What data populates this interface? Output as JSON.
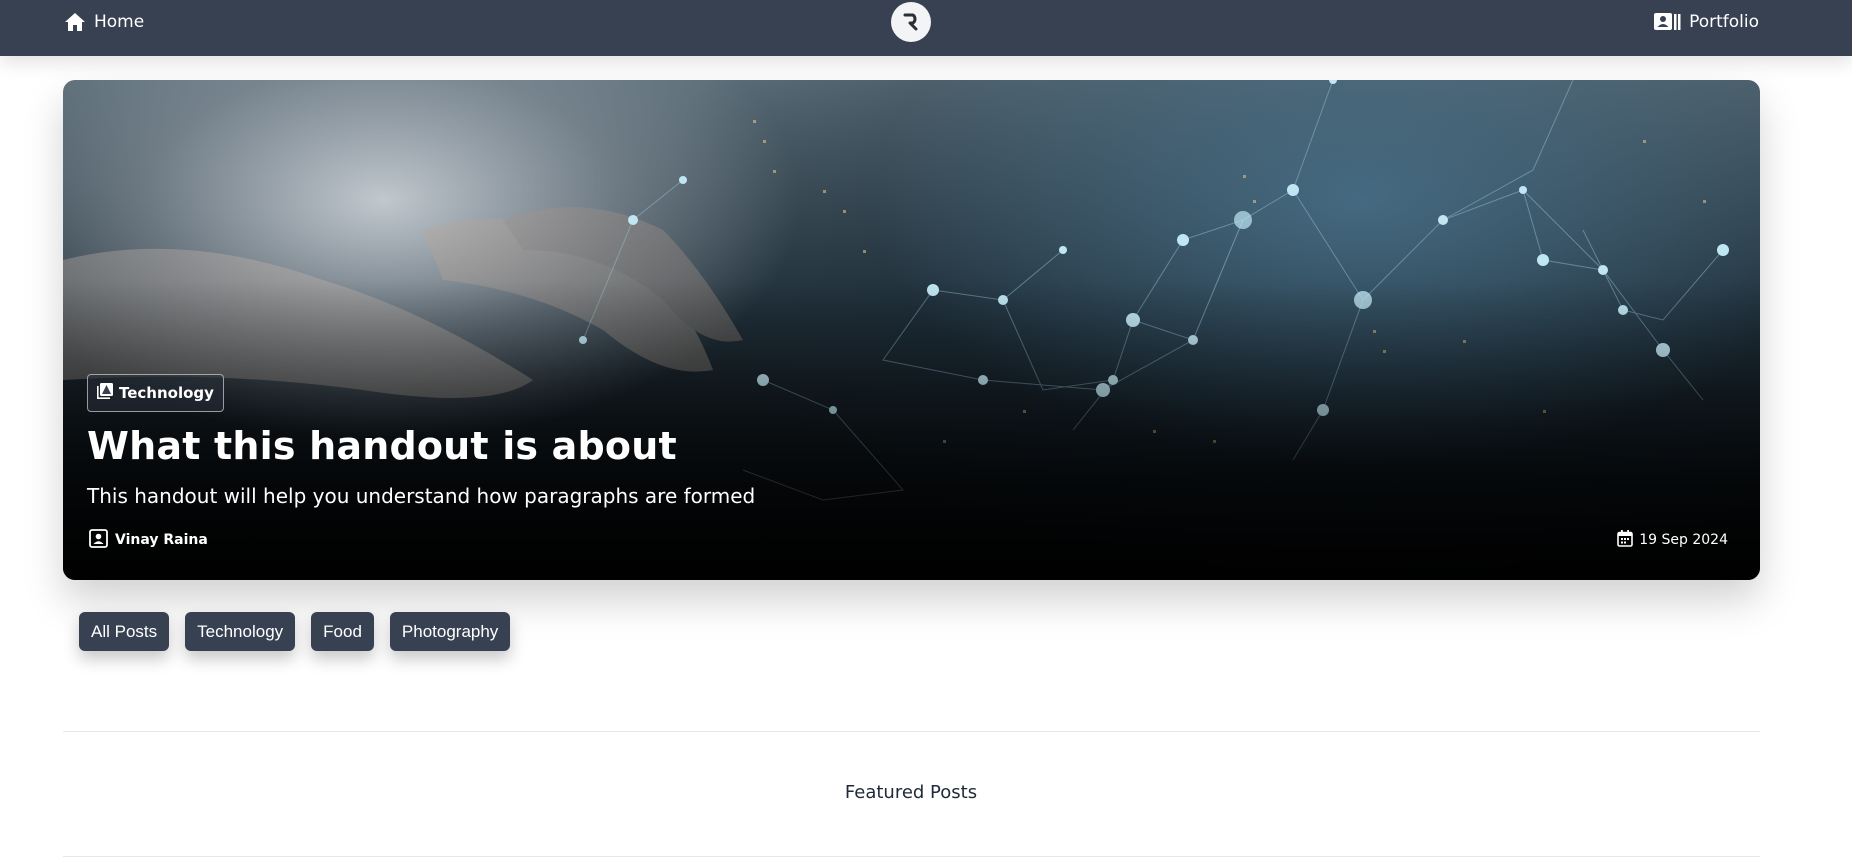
{
  "nav": {
    "home_label": "Home",
    "portfolio_label": "Portfolio",
    "logo_letter": "R",
    "home_icon": "house-icon",
    "portfolio_icon": "id-card-icon"
  },
  "hero": {
    "category": "Technology",
    "category_icon": "image-frame-icon",
    "title": "What this handout is about",
    "subtitle": "This handout will help you understand how paragraphs are formed",
    "author": "Vinay Raina",
    "author_icon": "user-square-icon",
    "date": "19 Sep 2024",
    "date_icon": "calendar-icon"
  },
  "filters": [
    "All Posts",
    "Technology",
    "Food",
    "Photography"
  ],
  "featured": {
    "title": "Featured Posts"
  },
  "colors": {
    "navbar": "#374151",
    "chip": "#374151",
    "page_bg": "#ffffff"
  }
}
